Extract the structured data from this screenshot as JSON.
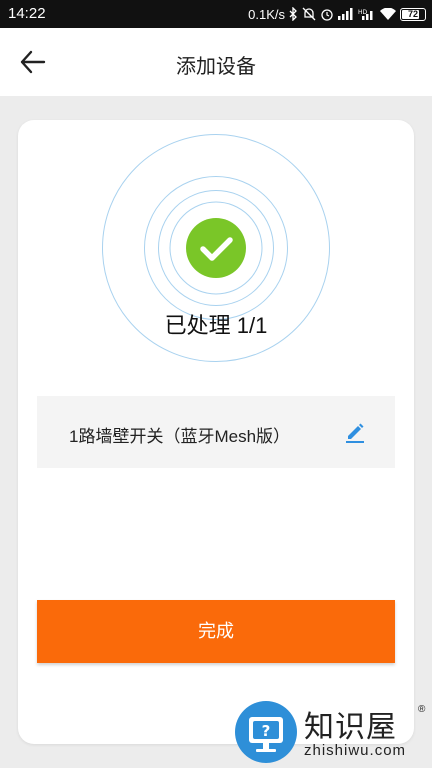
{
  "status_bar": {
    "time": "14:22",
    "net_speed": "0.1K/s",
    "battery_level": "72",
    "icons": [
      "bluetooth-icon",
      "alarm-icon",
      "signal-icon",
      "hd-signal-icon",
      "wifi-icon",
      "battery-icon"
    ]
  },
  "header": {
    "title": "添加设备",
    "back_icon": "back-arrow-icon"
  },
  "progress": {
    "status_text": "已处理 1/1",
    "success_icon": "check-circle-icon",
    "colors": {
      "success": "#7ac628",
      "ring": "#a9d2ef"
    }
  },
  "device": {
    "name": "1路墙壁开关（蓝牙Mesh版）",
    "edit_icon": "edit-pencil-icon",
    "edit_color": "#2f8fe0"
  },
  "actions": {
    "done_label": "完成",
    "done_color": "#fa6a0a"
  },
  "watermark": {
    "name_cn": "知识屋",
    "name_en": "zhishiwu.com",
    "reg": "®"
  }
}
